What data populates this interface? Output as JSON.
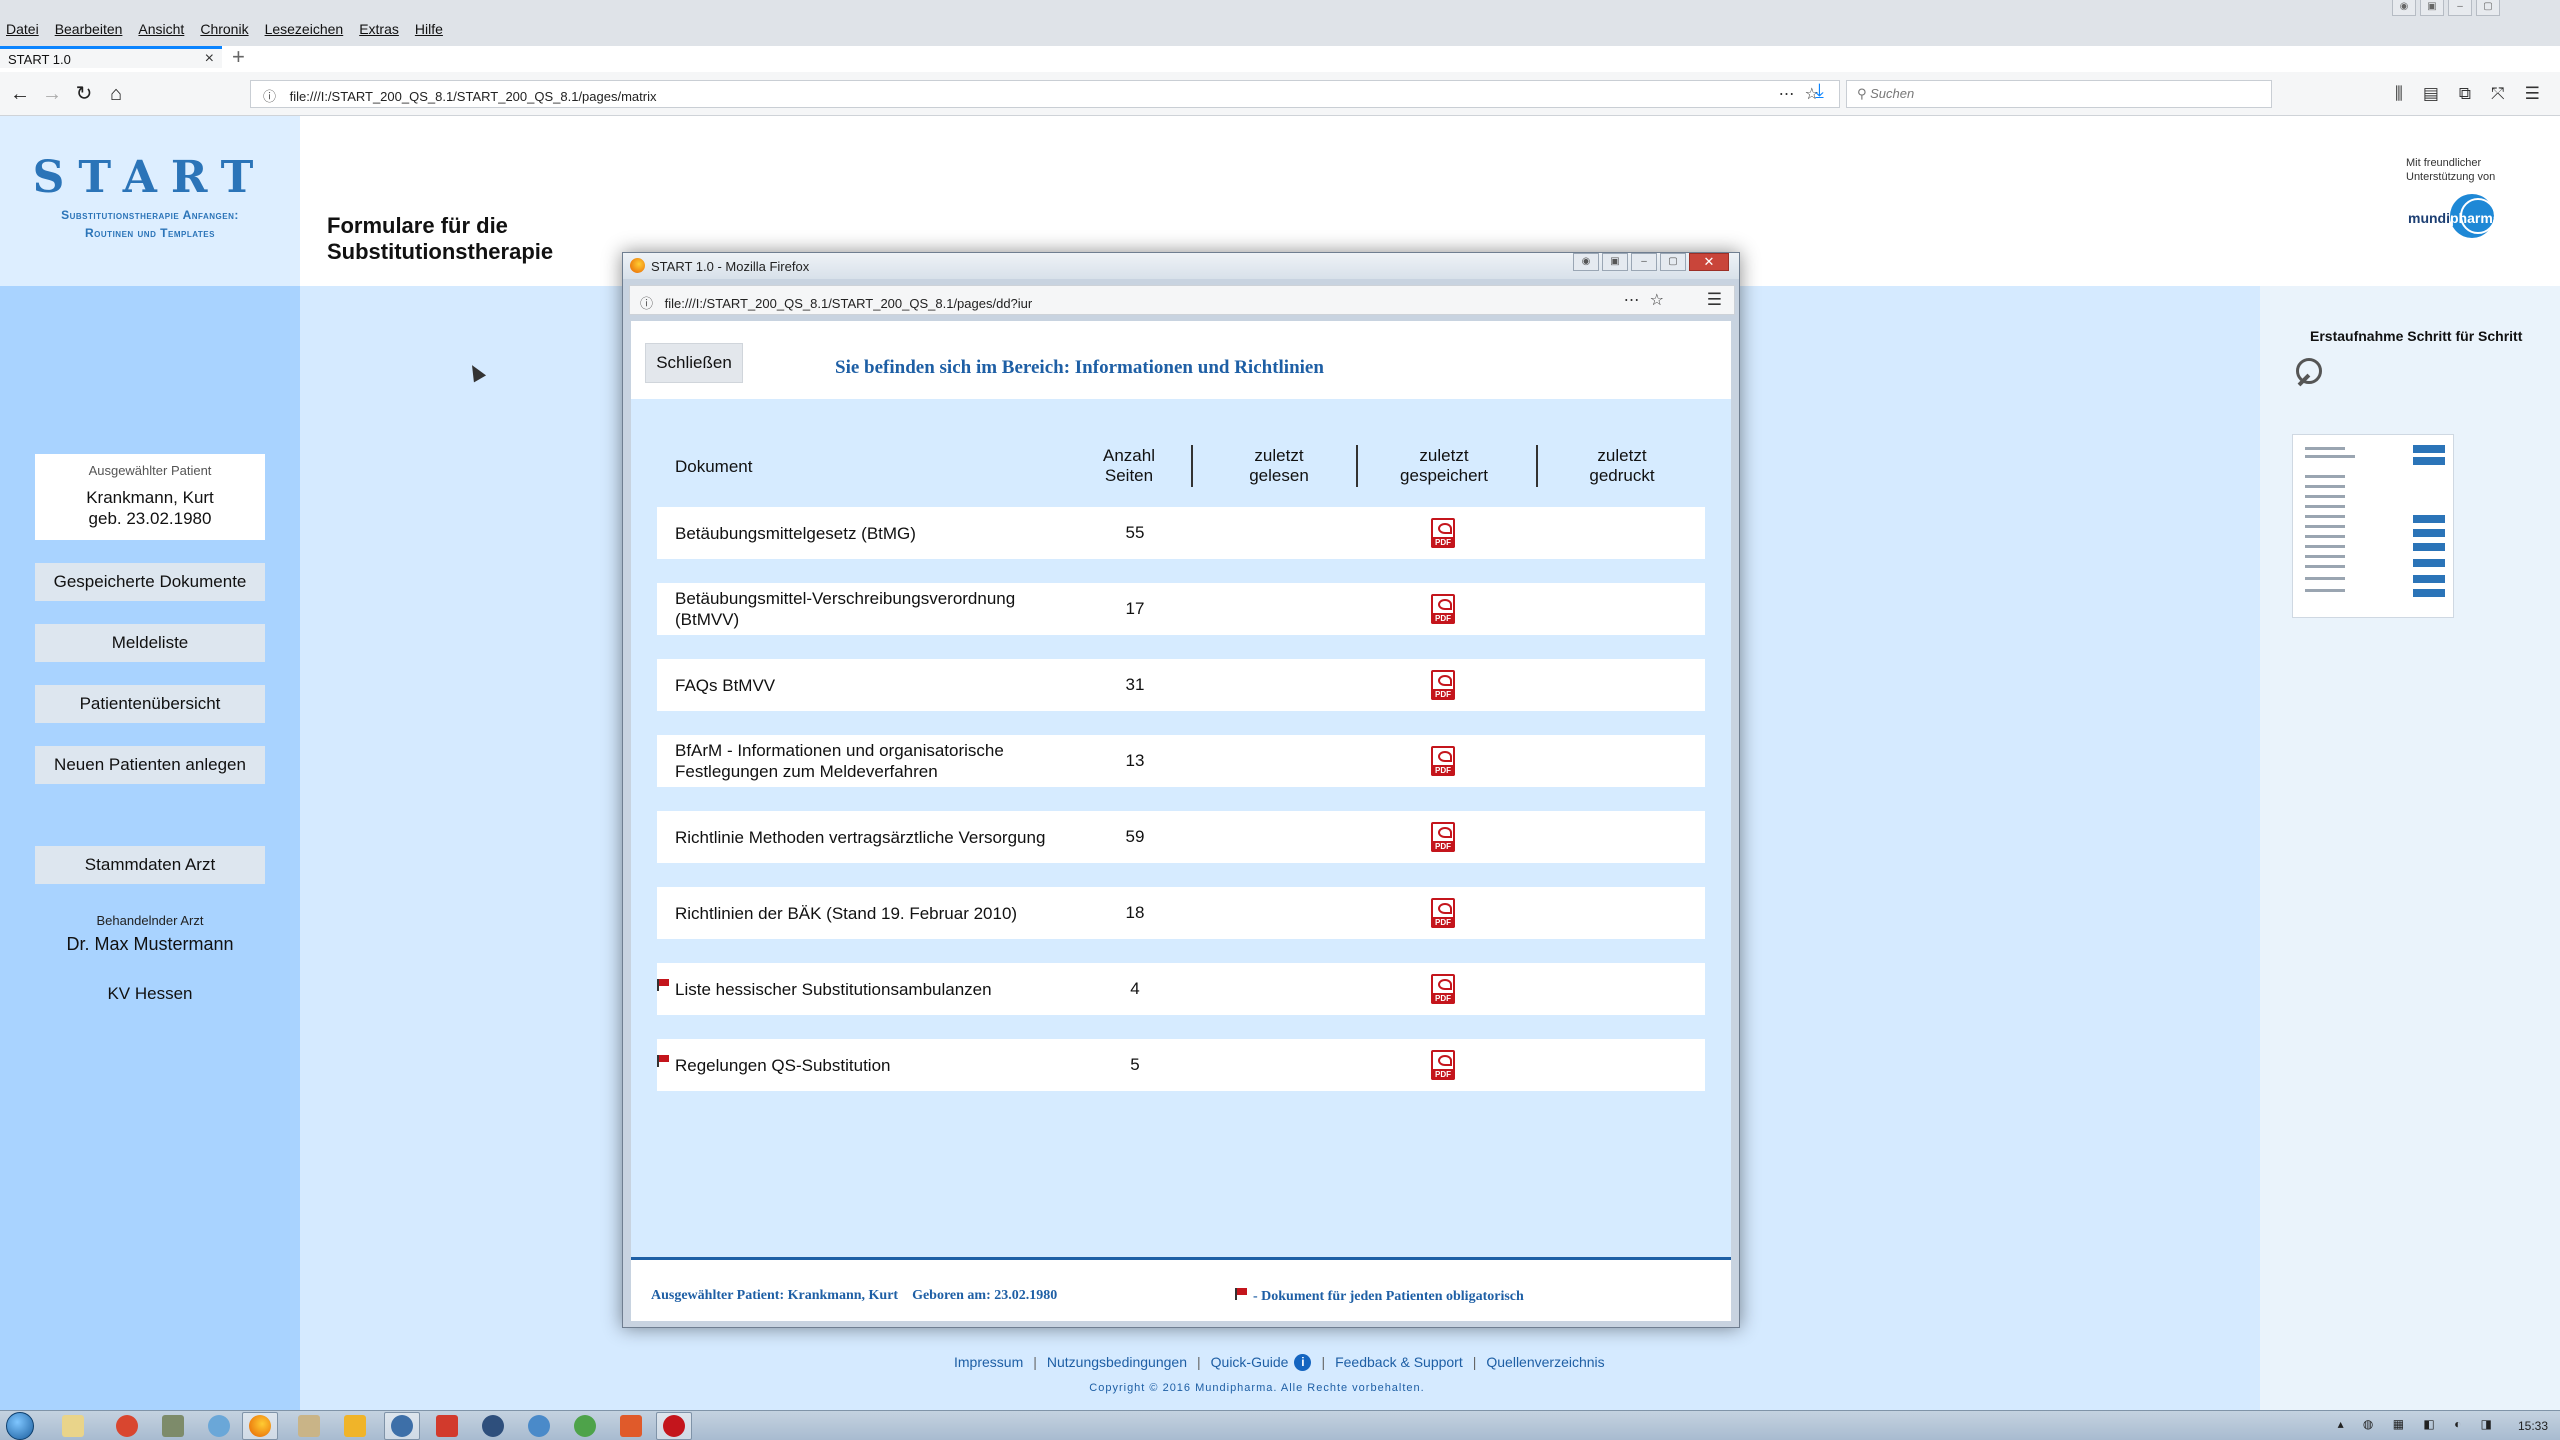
{
  "browser": {
    "menu": [
      "Datei",
      "Bearbeiten",
      "Ansicht",
      "Chronik",
      "Lesezeichen",
      "Extras",
      "Hilfe"
    ],
    "tab_title": "START 1.0",
    "tab_close": "×",
    "new_tab": "+",
    "url": "file:///I:/START_200_QS_8.1/START_200_QS_8.1/pages/matrix",
    "search_placeholder": "Suchen"
  },
  "logo": {
    "title": "START",
    "subtitle_line1": "Substitutionstherapie Anfangen:",
    "subtitle_line2": "Routinen und Templates"
  },
  "page_title_line1": "Formulare für die",
  "page_title_line2": "Substitutionstherapie",
  "sponsor": {
    "line1": "Mit freundlicher",
    "line2": "Unterstützung von",
    "brand_left": "mundi",
    "brand_right": "pharma"
  },
  "sidebar": {
    "patient_label": "Ausgewählter Patient",
    "patient_name": "Krankmann, Kurt",
    "patient_dob": "geb. 23.02.1980",
    "buttons": [
      "Gespeicherte Dokumente",
      "Meldeliste",
      "Patientenübersicht",
      "Neuen Patienten anlegen"
    ],
    "stammdaten_button": "Stammdaten Arzt",
    "arzt_label": "Behandelnder Arzt",
    "arzt_name": "Dr. Max Mustermann",
    "kv": "KV Hessen"
  },
  "right_panel": {
    "title": "Erstaufnahme Schritt für Schritt"
  },
  "popup": {
    "window_title": "START 1.0 - Mozilla Firefox",
    "url": "file:///I:/START_200_QS_8.1/START_200_QS_8.1/pages/dd?iur",
    "close_button": "Schließen",
    "heading": "Sie befinden sich im Bereich: Informationen und Richtlinien",
    "columns": {
      "dokument": "Dokument",
      "anzahl_1": "Anzahl",
      "anzahl_2": "Seiten",
      "gelesen_1": "zuletzt",
      "gelesen_2": "gelesen",
      "gespeichert_1": "zuletzt",
      "gespeichert_2": "gespeichert",
      "gedruckt_1": "zuletzt",
      "gedruckt_2": "gedruckt"
    },
    "rows": [
      {
        "doc": "Betäubungsmittelgesetz (BtMG)",
        "pages": "55",
        "mandatory": false
      },
      {
        "doc": "Betäubungsmittel-Verschreibungsverordnung (BtMVV)",
        "pages": "17",
        "mandatory": false
      },
      {
        "doc": "FAQs BtMVV",
        "pages": "31",
        "mandatory": false
      },
      {
        "doc": "BfArM - Informationen und organisatorische Festlegungen zum Meldeverfahren",
        "pages": "13",
        "mandatory": false
      },
      {
        "doc": "Richtlinie Methoden vertragsärztliche Versorgung",
        "pages": "59",
        "mandatory": false
      },
      {
        "doc": "Richtlinien der BÄK (Stand 19. Februar 2010)",
        "pages": "18",
        "mandatory": false
      },
      {
        "doc": "Liste hessischer Substitutionsambulanzen",
        "pages": "4",
        "mandatory": true
      },
      {
        "doc": "Regelungen QS-Substitution",
        "pages": "5",
        "mandatory": true
      }
    ],
    "pdf_label": "PDF",
    "footer_patient": "Ausgewählter Patient: Krankmann, Kurt",
    "footer_dob": "Geboren am: 23.02.1980",
    "footer_legend": "- Dokument für jeden Patienten obligatorisch"
  },
  "footer": {
    "links": [
      "Impressum",
      "Nutzungsbedingungen",
      "Quick-Guide",
      "Feedback & Support",
      "Quellenverzeichnis"
    ],
    "info_symbol": "i",
    "copyright": "Copyright © 2016 Mundipharma. Alle Rechte vorbehalten."
  },
  "taskbar": {
    "clock": "15:33"
  },
  "colors": {
    "accent_blue": "#1e5fa5",
    "left_panel": "#a9d3ff",
    "pdf_red": "#c4151c"
  }
}
